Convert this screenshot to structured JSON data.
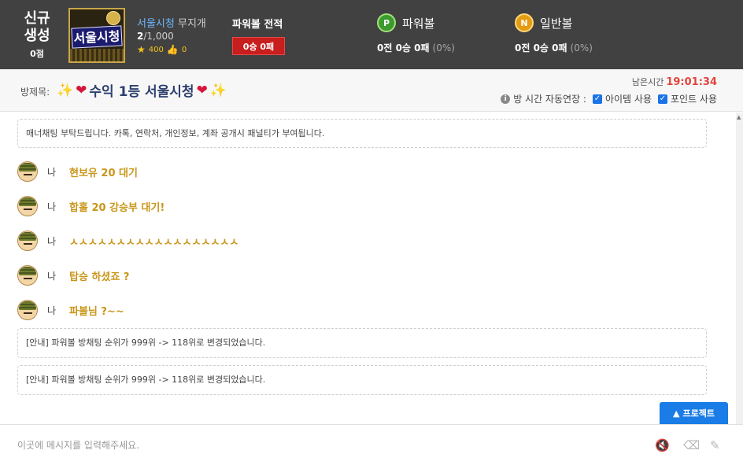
{
  "header": {
    "new_room_line1": "신규",
    "new_room_line2": "생성",
    "new_room_score": "0점",
    "thumb_logo_text": "서울시청",
    "owner_name": "서울시청",
    "owner_suffix": "무지개",
    "members_current": "2",
    "members_max": "/1,000",
    "stars": "400",
    "likes": "0",
    "record_title": "파워볼 전적",
    "record_value": "0승 0패",
    "powerball": {
      "icon_letter": "P",
      "label": "파워볼",
      "record": "0전 0승 0패",
      "pct": "(0%)"
    },
    "normalball": {
      "icon_letter": "N",
      "label": "일반볼",
      "record": "0전 0승 0패",
      "pct": "(0%)"
    }
  },
  "room": {
    "label": "방제목:",
    "title": "수익 1등 서울시청",
    "time_label": "남은시간",
    "time_value": "19:01:34",
    "auto_extend_label": "방 시간 자동연장 :",
    "option_item": "아이템 사용",
    "option_point": "포인트 사용"
  },
  "chat": {
    "top_notice": "매너채팅 부탁드립니다. 카톡, 연락처, 개인정보, 계좌 공개시 패널티가 부여됩니다.",
    "messages": [
      {
        "who": "나",
        "text": "현보유 20 대기"
      },
      {
        "who": "나",
        "text": "합홀 20 강승부 대기!"
      },
      {
        "who": "나",
        "text": "ㅅㅅㅅㅅㅅㅅㅅㅅㅅㅅㅅㅅㅅㅅㅅㅅㅅㅅ"
      },
      {
        "who": "나",
        "text": "탑승 하셨죠 ?"
      },
      {
        "who": "나",
        "text": "파볼님 ?~~"
      }
    ],
    "system_notices": [
      "[안내] 파워볼 방채팅 순위가 999위 -> 118위로 변경되었습니다.",
      "[안내] 파워볼 방채팅 순위가 999위 -> 118위로 변경되었습니다."
    ],
    "protect_button": "프로젝트"
  },
  "input": {
    "placeholder": "이곳에 메시지를 입력해주세요."
  },
  "colors": {
    "header_bg": "#414141",
    "message_text": "#c8961a",
    "time_value": "#e0453d",
    "record_red": "#c81e1e",
    "accent_blue": "#1a7ce6"
  },
  "icons": [
    "star-icon",
    "thumbs-up-icon",
    "powerball-icon",
    "normalball-icon",
    "sparkle-icon",
    "heart-icon",
    "info-icon",
    "checkbox-icon",
    "mute-icon",
    "eraser-icon",
    "magic-wand-icon",
    "caret-up-icon"
  ]
}
